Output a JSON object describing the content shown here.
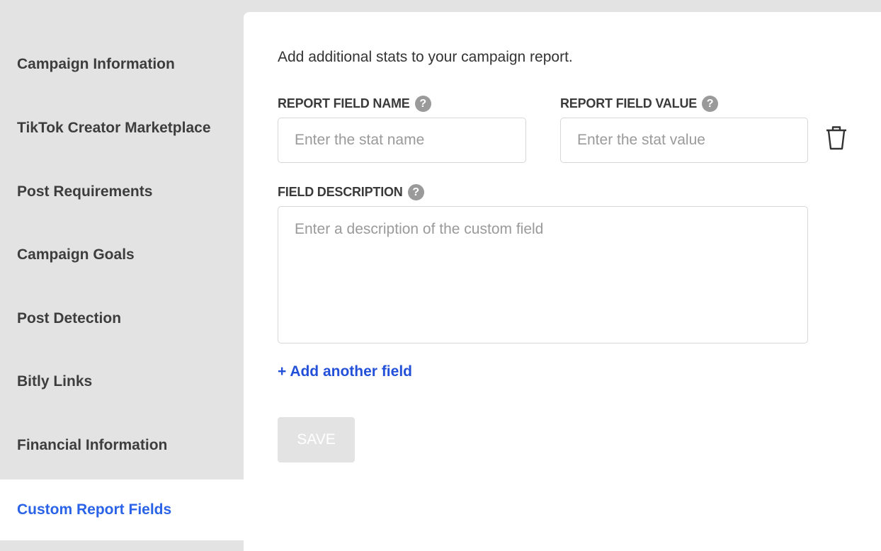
{
  "sidebar": {
    "items": [
      {
        "label": "Campaign Information",
        "active": false
      },
      {
        "label": "TikTok Creator Marketplace",
        "active": false
      },
      {
        "label": "Post Requirements",
        "active": false
      },
      {
        "label": "Campaign Goals",
        "active": false
      },
      {
        "label": "Post Detection",
        "active": false
      },
      {
        "label": "Bitly Links",
        "active": false
      },
      {
        "label": "Financial Information",
        "active": false
      },
      {
        "label": "Custom Report Fields",
        "active": true
      }
    ],
    "active_color": "#2a62e8"
  },
  "main": {
    "intro": "Add additional stats to your campaign report.",
    "field_name": {
      "label": "REPORT FIELD NAME",
      "help_icon": "?",
      "value": "",
      "placeholder": "Enter the stat name"
    },
    "field_value": {
      "label": "REPORT FIELD VALUE",
      "help_icon": "?",
      "value": "",
      "placeholder": "Enter the stat value"
    },
    "field_description": {
      "label": "FIELD DESCRIPTION",
      "help_icon": "?",
      "value": "",
      "placeholder": "Enter a description of the custom field"
    },
    "delete_icon": "trash-icon",
    "add_link": "+ Add another field",
    "save_label": "SAVE",
    "save_disabled": true
  }
}
